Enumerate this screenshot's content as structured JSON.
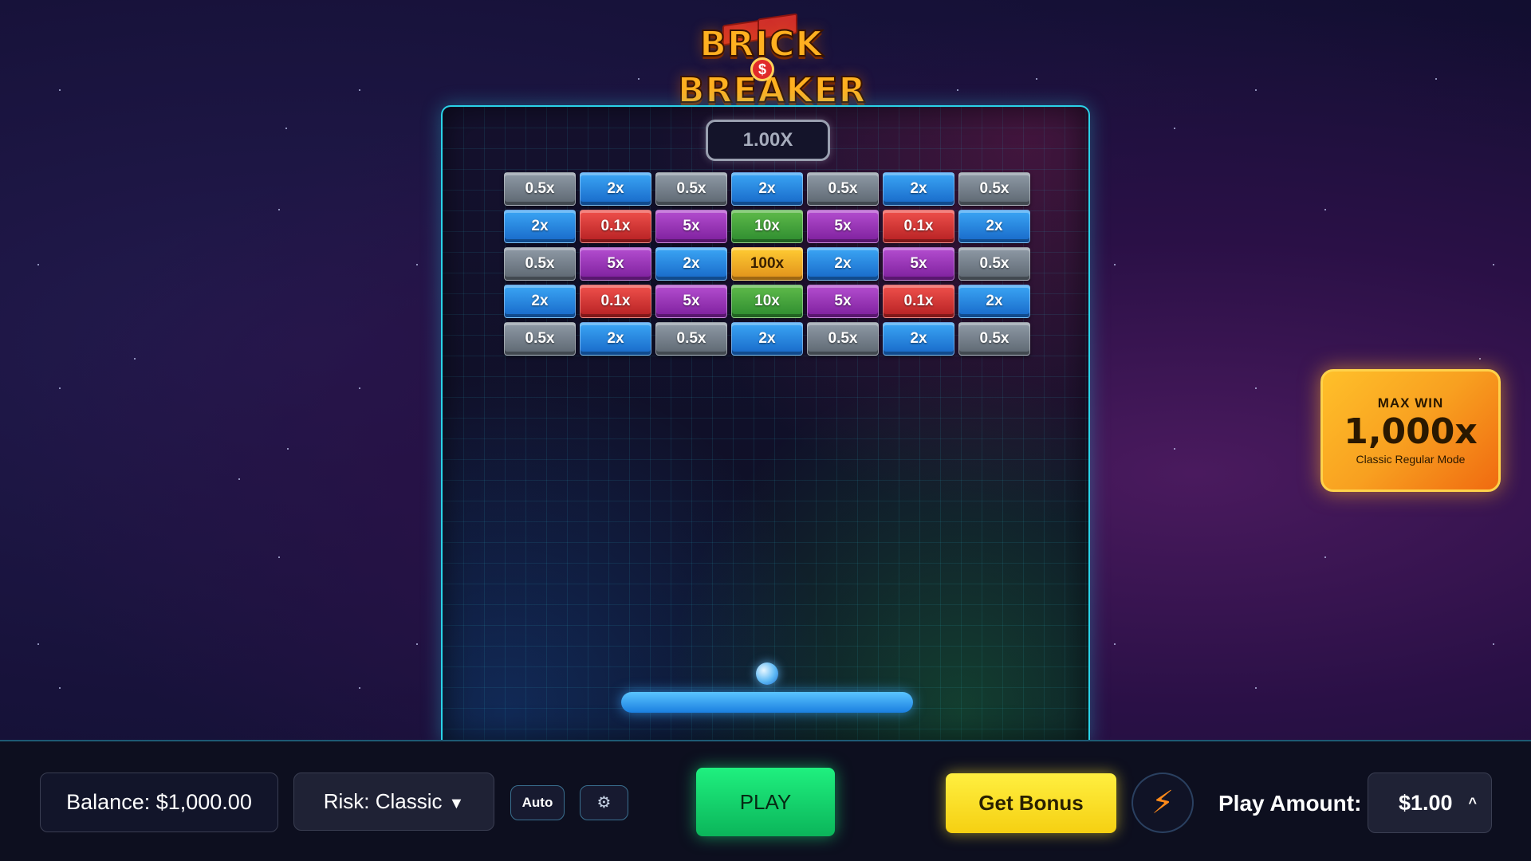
{
  "logo": {
    "line1": "BRICK",
    "line2": "BREAKER",
    "coin": "$"
  },
  "game": {
    "multiplier": "1.00X",
    "bricks": [
      [
        {
          "label": "0.5x",
          "color": "gray"
        },
        {
          "label": "2x",
          "color": "blue"
        },
        {
          "label": "0.5x",
          "color": "gray"
        },
        {
          "label": "2x",
          "color": "blue"
        },
        {
          "label": "0.5x",
          "color": "gray"
        },
        {
          "label": "2x",
          "color": "blue"
        },
        {
          "label": "0.5x",
          "color": "gray"
        }
      ],
      [
        {
          "label": "2x",
          "color": "blue"
        },
        {
          "label": "0.1x",
          "color": "red"
        },
        {
          "label": "5x",
          "color": "purple"
        },
        {
          "label": "10x",
          "color": "green"
        },
        {
          "label": "5x",
          "color": "purple"
        },
        {
          "label": "0.1x",
          "color": "red"
        },
        {
          "label": "2x",
          "color": "blue"
        }
      ],
      [
        {
          "label": "0.5x",
          "color": "gray"
        },
        {
          "label": "5x",
          "color": "purple"
        },
        {
          "label": "2x",
          "color": "blue"
        },
        {
          "label": "100x",
          "color": "gold"
        },
        {
          "label": "2x",
          "color": "blue"
        },
        {
          "label": "5x",
          "color": "purple"
        },
        {
          "label": "0.5x",
          "color": "gray"
        }
      ],
      [
        {
          "label": "2x",
          "color": "blue"
        },
        {
          "label": "0.1x",
          "color": "red"
        },
        {
          "label": "5x",
          "color": "purple"
        },
        {
          "label": "10x",
          "color": "green"
        },
        {
          "label": "5x",
          "color": "purple"
        },
        {
          "label": "0.1x",
          "color": "red"
        },
        {
          "label": "2x",
          "color": "blue"
        }
      ],
      [
        {
          "label": "0.5x",
          "color": "gray"
        },
        {
          "label": "2x",
          "color": "blue"
        },
        {
          "label": "0.5x",
          "color": "gray"
        },
        {
          "label": "2x",
          "color": "blue"
        },
        {
          "label": "0.5x",
          "color": "gray"
        },
        {
          "label": "2x",
          "color": "blue"
        },
        {
          "label": "0.5x",
          "color": "gray"
        }
      ]
    ]
  },
  "max_win": {
    "label": "MAX WIN",
    "value": "1,000x",
    "mode": "Classic Regular Mode"
  },
  "controls": {
    "balance": "Balance: $1,000.00",
    "risk": "Risk: Classic",
    "risk_arrow": "▼",
    "auto": "Auto",
    "settings_icon": "⚙",
    "play": "PLAY",
    "get_bonus": "Get Bonus",
    "lightning_icon": "⚡",
    "play_amount_label": "Play Amount:",
    "play_amount": "$1.00",
    "amount_caret": "^"
  },
  "colors": {
    "frame_border": "#2ad2e8",
    "play": "#1ff07f",
    "bonus": "#ffef40",
    "max_win": "#ffc02a"
  }
}
